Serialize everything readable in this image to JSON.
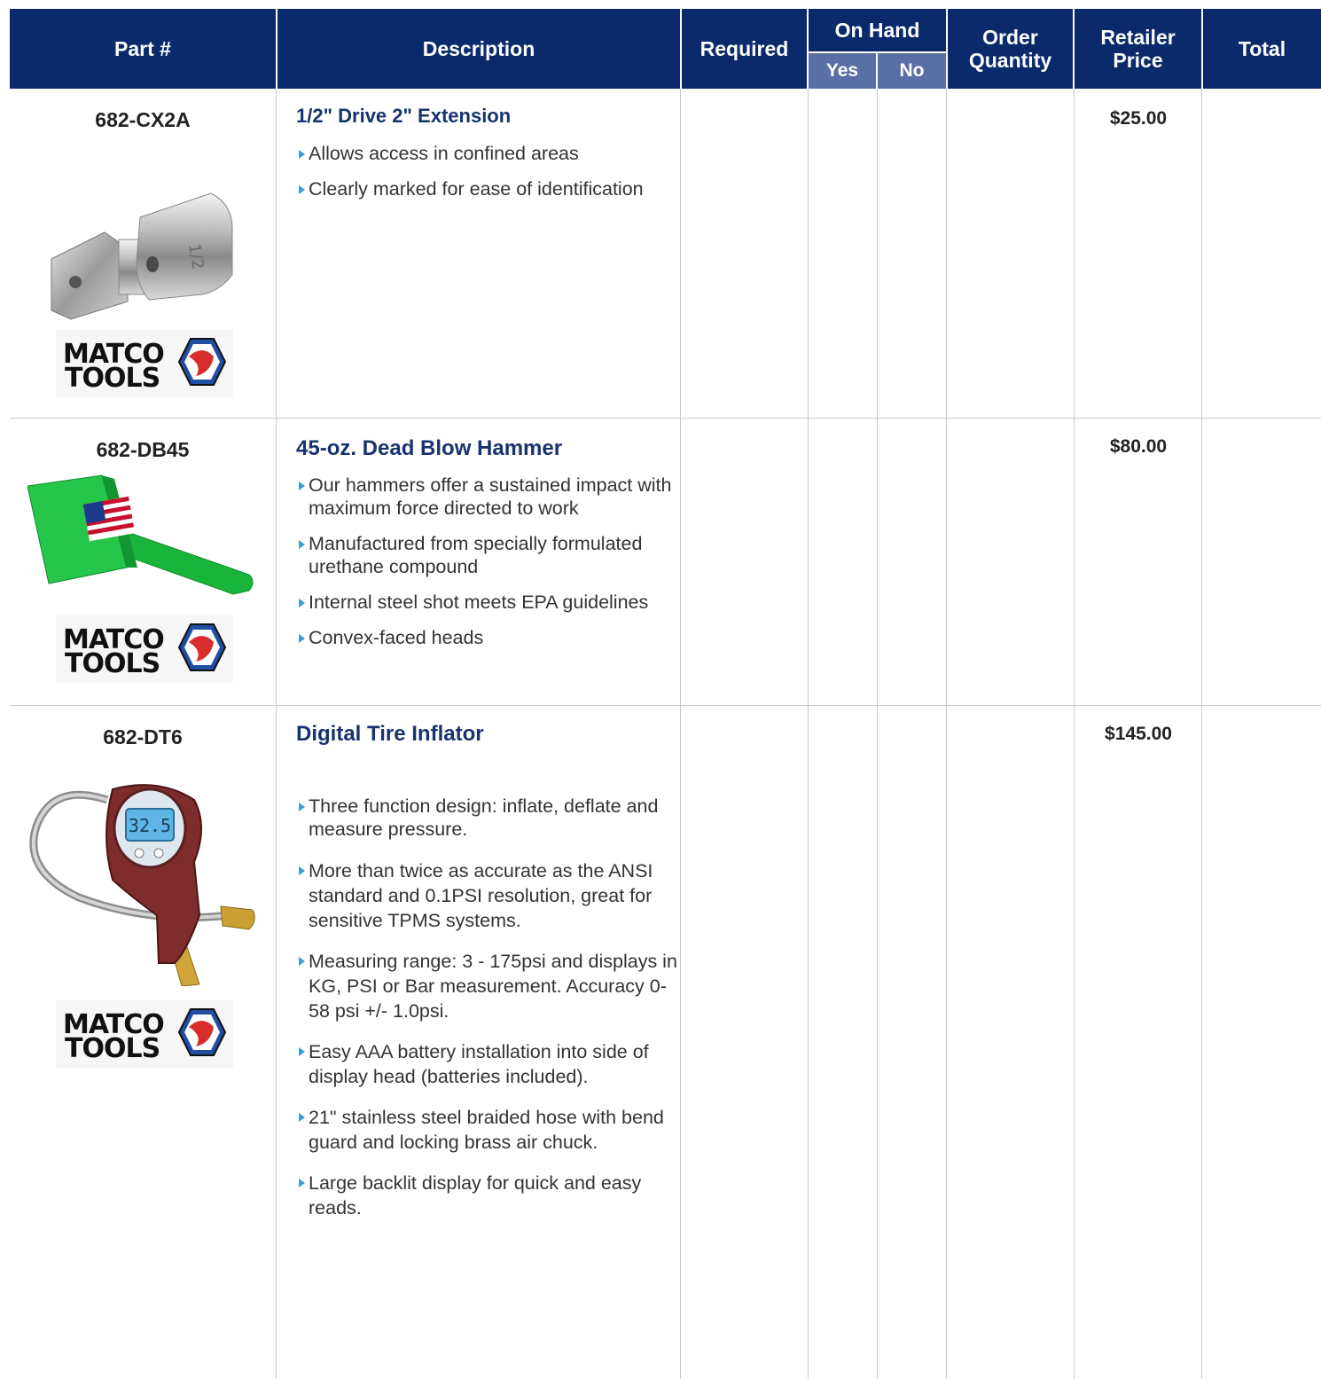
{
  "headers": {
    "part": "Part #",
    "description": "Description",
    "required": "Required",
    "on_hand": "On Hand",
    "yes": "Yes",
    "no": "No",
    "order_line1": "Order",
    "order_line2": "Quantity",
    "retailer_line1": "Retailer",
    "retailer_line2": "Price",
    "total": "Total"
  },
  "colors": {
    "header_bg": "#0b2a6b",
    "subheader_bg": "#5a6fa3",
    "title": "#17336f",
    "bullet": "#2fa3d6"
  },
  "products": [
    {
      "part": "682-CX2A",
      "title": "1/2\" Drive 2\" Extension",
      "price": "$25.00",
      "image": "socket-extension-image",
      "logo": {
        "line1": "MATCO",
        "line2": "TOOLS"
      },
      "bullets": [
        "Allows access in confined areas",
        "Clearly marked for ease of identification"
      ]
    },
    {
      "part": "682-DB45",
      "title": "45-oz. Dead Blow Hammer",
      "price": "$80.00",
      "image": "dead-blow-hammer-image",
      "logo": {
        "line1": "MATCO",
        "line2": "TOOLS"
      },
      "bullets": [
        "Our hammers offer a sustained impact with maximum force directed to work",
        "Manufactured from specially formulated urethane compound",
        "Internal steel shot meets EPA guidelines",
        "Convex-faced heads"
      ]
    },
    {
      "part": "682-DT6",
      "title": "Digital Tire Inflator",
      "price": "$145.00",
      "image": "tire-inflator-image",
      "display_reading": "32.5",
      "logo": {
        "line1": "MATCO",
        "line2": "TOOLS"
      },
      "bullets": [
        "Three function design: inflate, deflate and measure pressure.",
        "More than twice as accurate as the ANSI standard and 0.1PSI resolution, great for sensitive TPMS systems.",
        "Measuring range: 3 - 175psi and displays in KG, PSI or Bar measurement. Accuracy 0-58 psi +/- 1.0psi.",
        "Easy AAA battery installation into side of display head (batteries included).",
        "21\" stainless steel braided hose with bend guard and locking brass air chuck.",
        "Large backlit display for quick and easy reads."
      ]
    }
  ]
}
